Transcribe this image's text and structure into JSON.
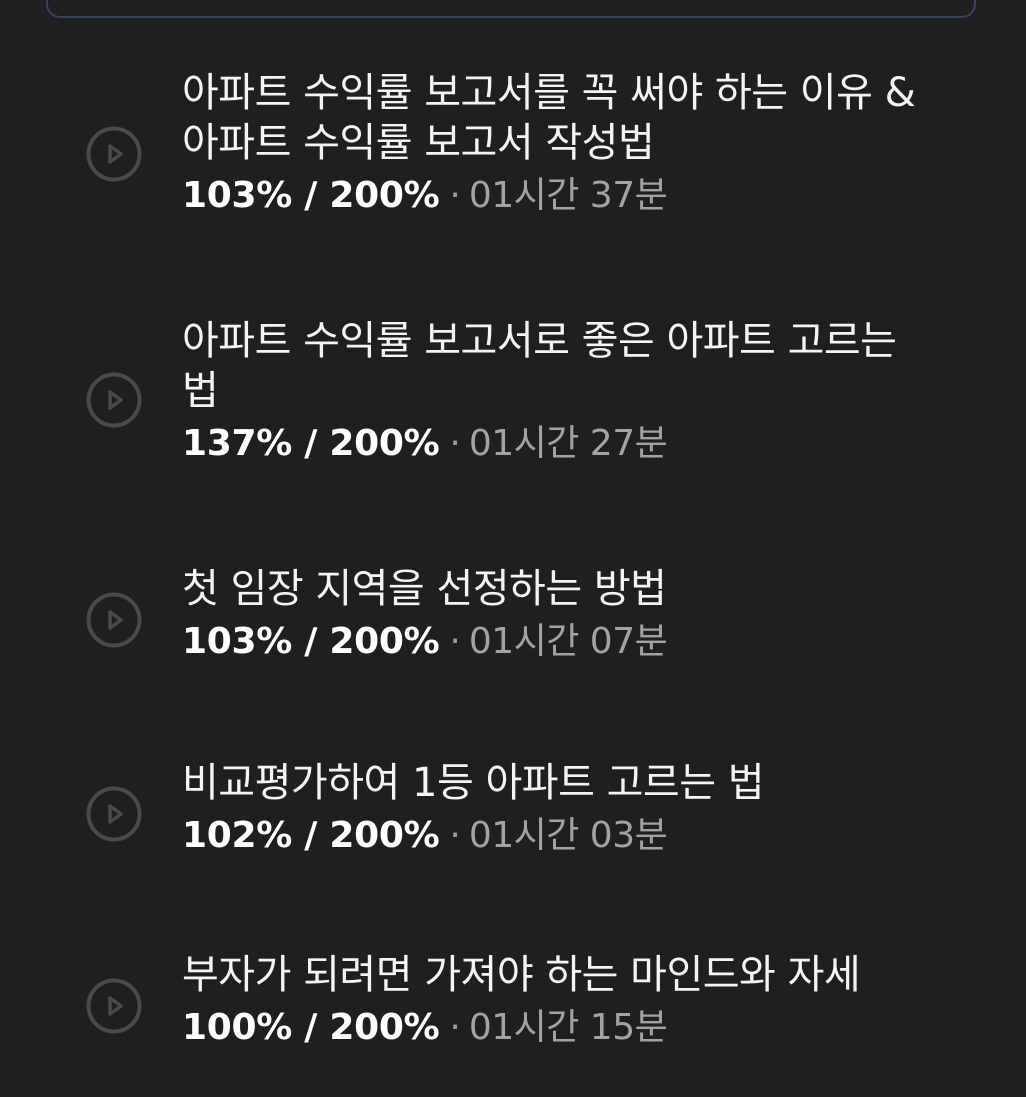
{
  "lessons": [
    {
      "title_lines": [
        "아파트 수익률 보고서를 꼭 써야 하는 이유 &",
        "아파트 수익률 보고서 작성법"
      ],
      "speed": "103% / 200%",
      "separator": "·",
      "duration": "01시간 37분"
    },
    {
      "title_lines": [
        "아파트 수익률 보고서로 좋은 아파트 고르는",
        "법"
      ],
      "speed": "137% / 200%",
      "separator": "·",
      "duration": "01시간 27분"
    },
    {
      "title_lines": [
        "첫 임장 지역을 선정하는 방법"
      ],
      "speed": "103% / 200%",
      "separator": "·",
      "duration": "01시간 07분"
    },
    {
      "title_lines": [
        "비교평가하여 1등 아파트 고르는 법"
      ],
      "speed": "102% / 200%",
      "separator": "·",
      "duration": "01시간 03분"
    },
    {
      "title_lines": [
        "부자가 되려면 가져야 하는 마인드와 자세"
      ],
      "speed": "100% / 200%",
      "separator": "·",
      "duration": "01시간 15분"
    }
  ],
  "icons": {
    "play": "play-circle-icon"
  },
  "colors": {
    "background": "#1f1f1f",
    "title_text": "#f4f4f4",
    "speed_text": "#ffffff",
    "duration_text": "#a3a3a3",
    "icon_stroke": "#4a4a4a",
    "top_box_border": "#3a4258"
  }
}
